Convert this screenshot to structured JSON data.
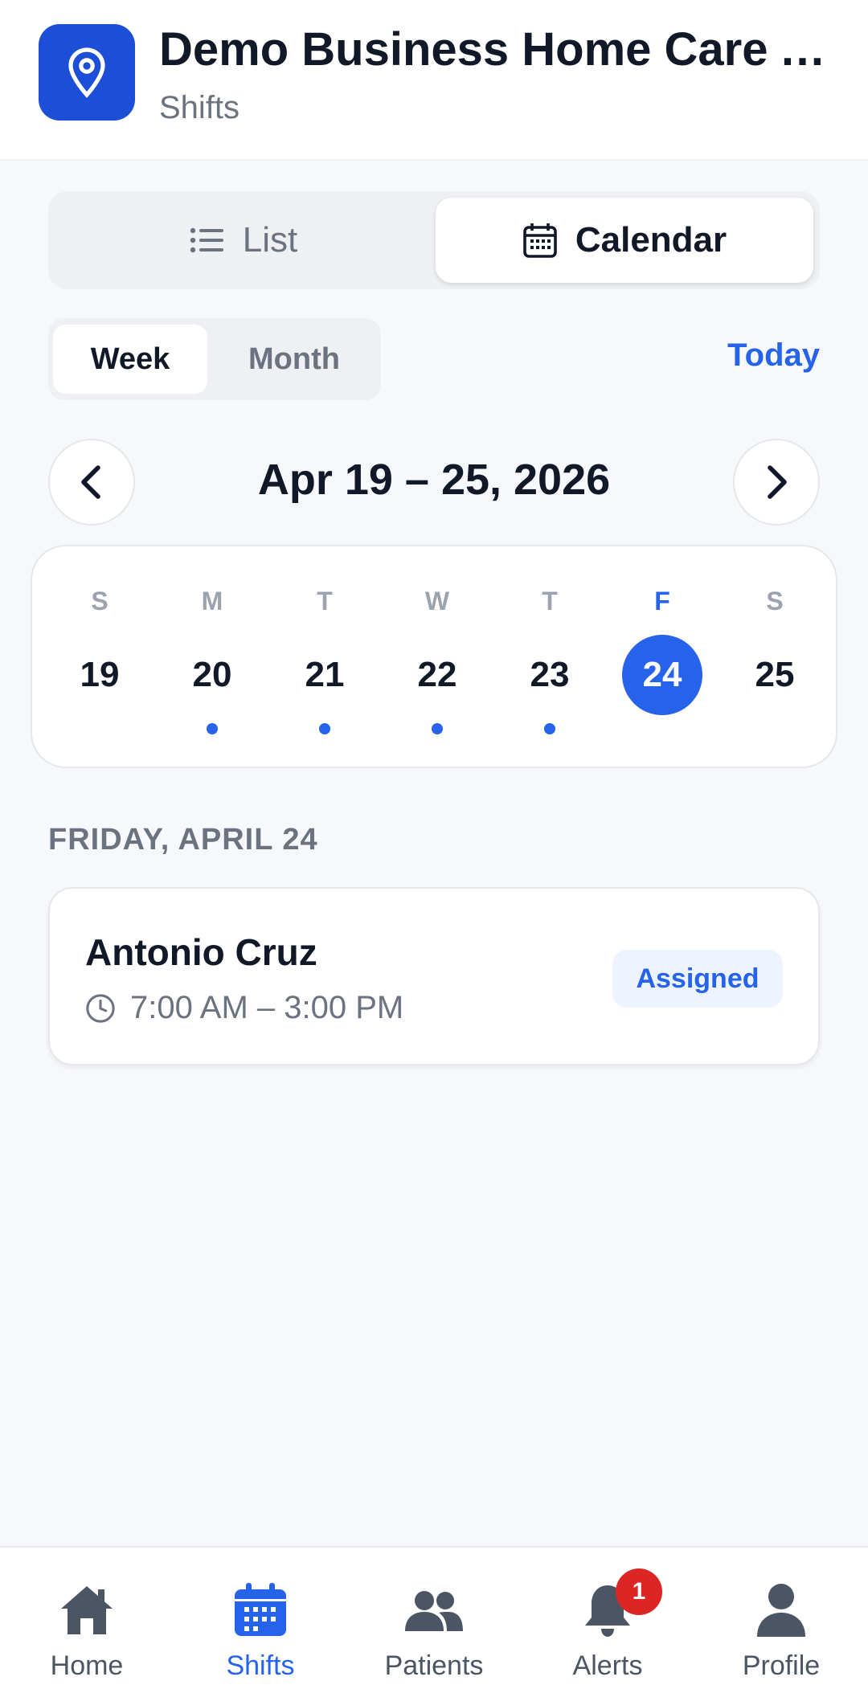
{
  "header": {
    "title": "Demo Business Home Care A…",
    "subtitle": "Shifts",
    "logo_icon": "map-pin-icon"
  },
  "view_toggle": {
    "list_label": "List",
    "calendar_label": "Calendar",
    "selected": "Calendar"
  },
  "range_toggle": {
    "week_label": "Week",
    "month_label": "Month",
    "selected": "Week",
    "today_label": "Today"
  },
  "date_nav": {
    "range_label": "Apr 19 – 25, 2026"
  },
  "week": {
    "days": [
      {
        "letter": "S",
        "num": "19",
        "has_shift": false,
        "selected": false
      },
      {
        "letter": "M",
        "num": "20",
        "has_shift": true,
        "selected": false
      },
      {
        "letter": "T",
        "num": "21",
        "has_shift": true,
        "selected": false
      },
      {
        "letter": "W",
        "num": "22",
        "has_shift": true,
        "selected": false
      },
      {
        "letter": "T",
        "num": "23",
        "has_shift": true,
        "selected": false
      },
      {
        "letter": "F",
        "num": "24",
        "has_shift": false,
        "selected": true
      },
      {
        "letter": "S",
        "num": "25",
        "has_shift": false,
        "selected": false
      }
    ]
  },
  "section": {
    "label": "FRIDAY, APRIL 24"
  },
  "shift": {
    "name": "Antonio Cruz",
    "time": "7:00 AM – 3:00 PM",
    "status": "Assigned"
  },
  "bottom_nav": {
    "items": [
      {
        "label": "Home",
        "icon": "home-icon"
      },
      {
        "label": "Shifts",
        "icon": "calendar-icon"
      },
      {
        "label": "Patients",
        "icon": "users-icon"
      },
      {
        "label": "Alerts",
        "icon": "bell-icon",
        "badge": "1"
      },
      {
        "label": "Profile",
        "icon": "user-icon"
      }
    ],
    "active": "Shifts"
  },
  "colors": {
    "accent": "#2563eb",
    "logo_bg": "#1d4ed8",
    "badge_red": "#dc2626",
    "background": "#f7f8fb"
  }
}
